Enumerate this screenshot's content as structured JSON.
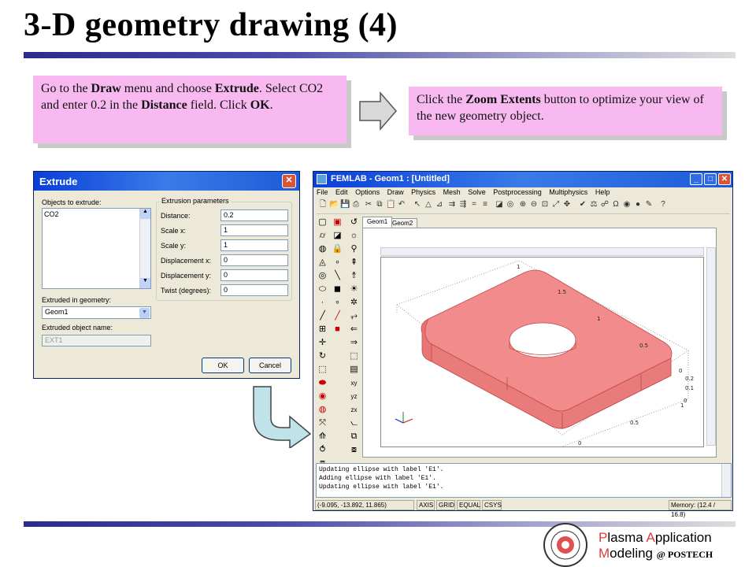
{
  "slide": {
    "title": "3-D geometry drawing (4)",
    "footer": {
      "brand_word1_initial": "P",
      "brand_word1_rest": "lasma ",
      "brand_word2_initial": "A",
      "brand_word2_rest": "pplication",
      "brand_line2_initial": "M",
      "brand_line2_rest": "odeling ",
      "brand_at": "@ POSTECH"
    }
  },
  "notes": {
    "step1": {
      "t1": "Go to the ",
      "b1": "Draw",
      "t2": " menu and choose ",
      "b2": "Extrude",
      "t3": ". Select CO2 and enter 0.2 in the ",
      "b3": "Distance",
      "t4": " field. Click ",
      "b4": "OK",
      "t5": "."
    },
    "step2": {
      "t1": "Click the ",
      "b1": "Zoom Extents",
      "t2": " button to optimize your view of the new geometry object."
    }
  },
  "extrude_dialog": {
    "title": "Extrude",
    "objects_label": "Objects to extrude:",
    "objects": [
      "CO2"
    ],
    "params_label": "Extrusion parameters",
    "params": [
      {
        "label": "Distance:",
        "value": "0.2"
      },
      {
        "label": "Scale x:",
        "value": "1"
      },
      {
        "label": "Scale y:",
        "value": "1"
      },
      {
        "label": "Displacement x:",
        "value": "0"
      },
      {
        "label": "Displacement y:",
        "value": "0"
      },
      {
        "label": "Twist (degrees):",
        "value": "0"
      }
    ],
    "extruded_in_label": "Extruded in geometry:",
    "extruded_in_value": "Geom1",
    "object_name_label": "Extruded object name:",
    "object_name_value": "EXT1",
    "ok": "OK",
    "cancel": "Cancel"
  },
  "femlab": {
    "title": "FEMLAB - Geom1 : [Untitled]",
    "menu": [
      "File",
      "Edit",
      "Options",
      "Draw",
      "Physics",
      "Mesh",
      "Solve",
      "Postprocessing",
      "Multiphysics",
      "Help"
    ],
    "tabs": [
      "Geom1",
      "Geom2"
    ],
    "log": [
      "Updating ellipse with label 'E1'.",
      "Adding ellipse with label 'E1'.",
      "Updating ellipse with label 'E1'."
    ],
    "status": {
      "coords": "(-9.095, -13.892, 11.865)",
      "axis": "AXIS",
      "grid": "GRID",
      "equal": "EQUAL",
      "csys": "CSYS",
      "memory": "Memory: (12.4 / 16.8)"
    },
    "axis_ticks": {
      "top": [
        "1",
        "1.5",
        "1",
        "0.5"
      ],
      "right": [
        "0",
        "0.2",
        "0.1",
        "0",
        "1"
      ],
      "bottom": [
        "0.5",
        "0"
      ]
    },
    "object_color": "#f08080"
  }
}
